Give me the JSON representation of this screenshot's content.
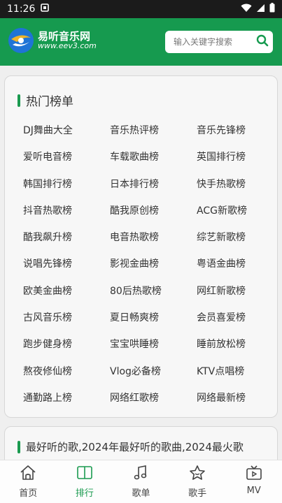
{
  "status_bar": {
    "time": "11:26",
    "icons": [
      "notification-icon",
      "wifi-icon",
      "signal-icon",
      "battery-icon"
    ]
  },
  "header": {
    "logo_title": "易听音乐网",
    "logo_url": "www.eev3.com",
    "search_placeholder": "输入关键字搜索",
    "brand_color": "#169a4f"
  },
  "hot_charts": {
    "title": "热门榜单",
    "items": [
      "DJ舞曲大全",
      "音乐热评榜",
      "音乐先锋榜",
      "爱听电音榜",
      "车载歌曲榜",
      "英国排行榜",
      "韩国排行榜",
      "日本排行榜",
      "快手热歌榜",
      "抖音热歌榜",
      "酷我原创榜",
      "ACG新歌榜",
      "酷我飙升榜",
      "电音热歌榜",
      "综艺新歌榜",
      "说唱先锋榜",
      "影视金曲榜",
      "粤语金曲榜",
      "欧美金曲榜",
      "80后热歌榜",
      "网红新歌榜",
      "古风音乐榜",
      "夏日畅爽榜",
      "会员喜爱榜",
      "跑步健身榜",
      "宝宝哄睡榜",
      "睡前放松榜",
      "熬夜修仙榜",
      "Vlog必备榜",
      "KTV点唱榜",
      "通勤路上榜",
      "网络红歌榜",
      "网络最新榜"
    ]
  },
  "next_section": {
    "title": "最好听的歌,2024年最好听的歌曲,2024最火歌"
  },
  "tab_bar": {
    "tabs": [
      {
        "label": "首页",
        "icon": "home-icon"
      },
      {
        "label": "排行",
        "icon": "book-icon",
        "active": true
      },
      {
        "label": "歌单",
        "icon": "music-note-icon"
      },
      {
        "label": "歌手",
        "icon": "star-person-icon"
      },
      {
        "label": "MV",
        "icon": "tv-icon"
      }
    ],
    "active_color": "#1a9a4f"
  }
}
